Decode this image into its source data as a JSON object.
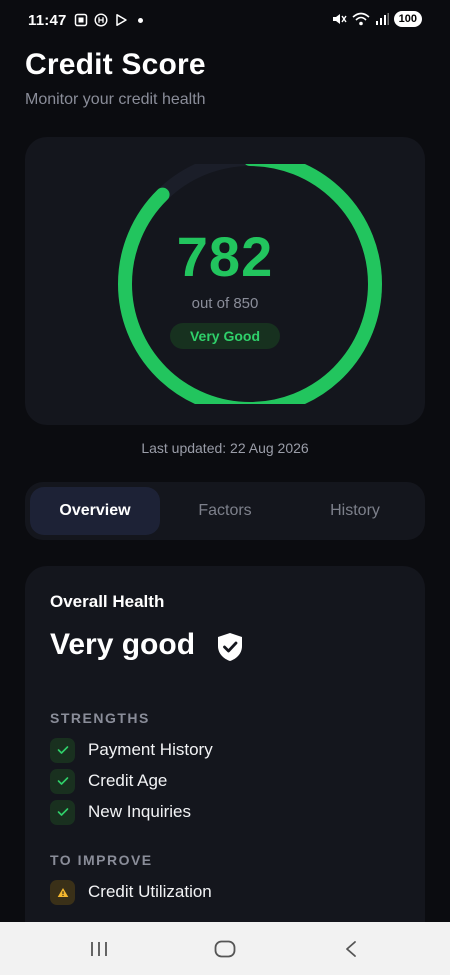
{
  "status_bar": {
    "time": "11:47",
    "battery": "100",
    "icons_left": [
      "screenshot-icon",
      "notification-h-icon",
      "play-icon",
      "dot-icon"
    ],
    "icons_right": [
      "mute-icon",
      "wifi-icon",
      "signal-icon",
      "battery-icon"
    ]
  },
  "header": {
    "title": "Credit Score",
    "subtitle": "Monitor your credit health"
  },
  "score": {
    "value": "782",
    "max_label": "out of 850",
    "rating": "Very Good",
    "value_num": 782,
    "min_num": 300,
    "max_num": 850,
    "accent_color": "#22c55e"
  },
  "last_updated": "Last updated: 22 Aug 2026",
  "tabs": [
    {
      "label": "Overview",
      "active": true
    },
    {
      "label": "Factors",
      "active": false
    },
    {
      "label": "History",
      "active": false
    }
  ],
  "health": {
    "label": "Overall Health",
    "status": "Very good",
    "strengths_title": "STRENGTHS",
    "strengths": [
      "Payment History",
      "Credit Age",
      "New Inquiries"
    ],
    "improve_title": "TO IMPROVE",
    "improve": [
      "Credit Utilization"
    ]
  },
  "nav": {
    "icons": [
      "recent-apps-icon",
      "home-icon",
      "back-icon"
    ]
  }
}
